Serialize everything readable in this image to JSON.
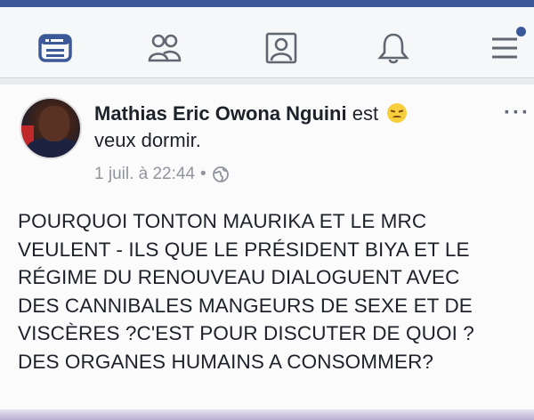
{
  "nav": {
    "items": [
      {
        "name": "news-feed",
        "icon": "news-feed-icon",
        "active": true
      },
      {
        "name": "friends",
        "icon": "friends-icon",
        "active": false
      },
      {
        "name": "profile",
        "icon": "profile-icon",
        "active": false
      },
      {
        "name": "notifications",
        "icon": "bell-icon",
        "active": false
      },
      {
        "name": "menu",
        "icon": "menu-icon",
        "active": false
      }
    ],
    "accent_color": "#3b5998",
    "inactive_color": "#606770"
  },
  "post": {
    "author": "Mathias Eric Owona Nguini",
    "status_prefix": " est ",
    "feeling": "veux dormir.",
    "timestamp": "1 juil. à 22:44",
    "separator": " • ",
    "privacy_icon": "globe-icon",
    "more_label": "···",
    "lines": [
      "POURQUOI TONTON MAURIKA ET LE MRC",
      "VEULENT - ILS QUE LE PRÉSIDENT BIYA ET LE",
      "RÉGIME DU RENOUVEAU DIALOGUENT AVEC",
      "DES CANNIBALES MANGEURS DE SEXE ET DE",
      "VISCÈRES ?C'EST POUR DISCUTER DE QUOI ?",
      "DES ORGANES HUMAINS A CONSOMMER?"
    ]
  }
}
